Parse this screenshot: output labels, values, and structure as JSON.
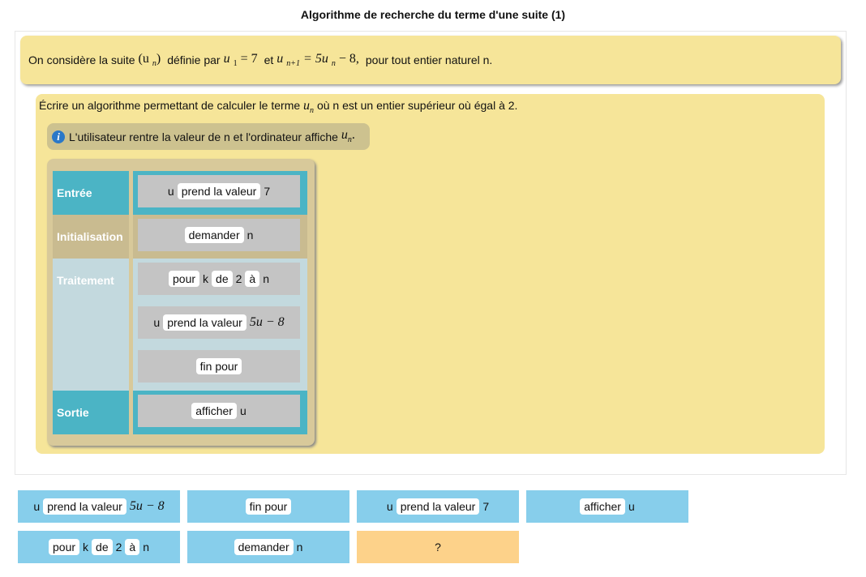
{
  "page": {
    "title": "Algorithme de recherche du terme d'une suite (1)"
  },
  "problem": {
    "t1": "On considère la suite",
    "m1_base": "(u",
    "m1_sub": "n",
    "m1_end": ")",
    "t2": "définie par",
    "m2_base": "u",
    "m2_sub": "1",
    "m2_rest": " = 7",
    "t3": "et",
    "m3_base": "u",
    "m3_sub": "n+1",
    "m3_mid": " = 5u",
    "m3_sub2": "n",
    "m3_end": " − 8,",
    "t4": "pour tout entier naturel n."
  },
  "task": {
    "t1": "Écrire un algorithme permettant de calculer le terme",
    "m_base": "u",
    "m_sub": "n",
    "t2": "où n est un entier supérieur où égal à 2."
  },
  "hint": {
    "icon": "info-icon",
    "text": "L'utilisateur rentre la valeur de n et l'ordinateur affiche",
    "m_base": "u",
    "m_sub": "n",
    "m_end": "."
  },
  "algorithm": {
    "sections": {
      "entree": "Entrée",
      "init": "Initialisation",
      "traitement": "Traitement",
      "sortie": "Sortie"
    },
    "slots": {
      "s1": {
        "pre": "u",
        "chip": "prend la valeur",
        "post": "7"
      },
      "s2": {
        "chip": "demander",
        "post": "n"
      },
      "s3": {
        "c1": "pour",
        "w1": "k",
        "c2": "de",
        "w2": "2",
        "c3": "à",
        "w3": "n"
      },
      "s4": {
        "pre": "u",
        "chip": "prend la valeur",
        "math": "5u − 8"
      },
      "s5": {
        "chip": "fin pour"
      },
      "s6": {
        "chip": "afficher",
        "post": "u"
      }
    }
  },
  "bank": {
    "b1": {
      "pre": "u",
      "chip": "prend la valeur",
      "math": "5u − 8"
    },
    "b2": {
      "chip": "fin pour"
    },
    "b3": {
      "pre": "u",
      "chip": "prend la valeur",
      "post": "7"
    },
    "b4": {
      "chip": "afficher",
      "post": "u"
    },
    "b5": {
      "c1": "pour",
      "w1": "k",
      "c2": "de",
      "w2": "2",
      "c3": "à",
      "w3": "n"
    },
    "b6": {
      "chip": "demander",
      "post": "n"
    },
    "b7": {
      "label": "?"
    }
  },
  "colors": {
    "panel": "#f6e599",
    "entree": "#4bb4c5",
    "init": "#c9bb90",
    "traitement": "#c3d9de",
    "slot": "#c4c4c4",
    "block": "#87ceeb",
    "unknown": "#fdd28a"
  }
}
